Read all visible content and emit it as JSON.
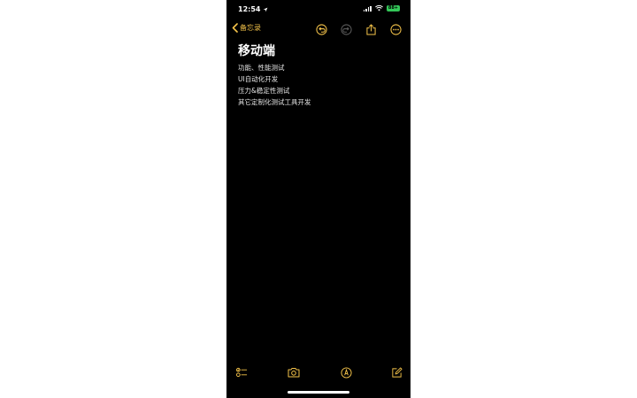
{
  "colors": {
    "accent": "#F4C34A",
    "background": "#000000",
    "text": "#FFFFFF",
    "battery": "#34C759",
    "disabled": "#5A5A5A"
  },
  "status_bar": {
    "time": "12:54",
    "battery_label": "88+"
  },
  "nav": {
    "back_label": "备忘录",
    "icons": [
      "back-chevron-icon",
      "undo-icon",
      "redo-icon",
      "share-icon",
      "more-icon"
    ]
  },
  "note": {
    "title": "移动端",
    "lines": [
      "功能、性能测试",
      "UI自动化开发",
      "压力&稳定性测试",
      "其它定制化测试工具开发"
    ]
  },
  "toolbar": {
    "icons": [
      "checklist-icon",
      "camera-icon",
      "markup-icon",
      "compose-icon"
    ]
  }
}
